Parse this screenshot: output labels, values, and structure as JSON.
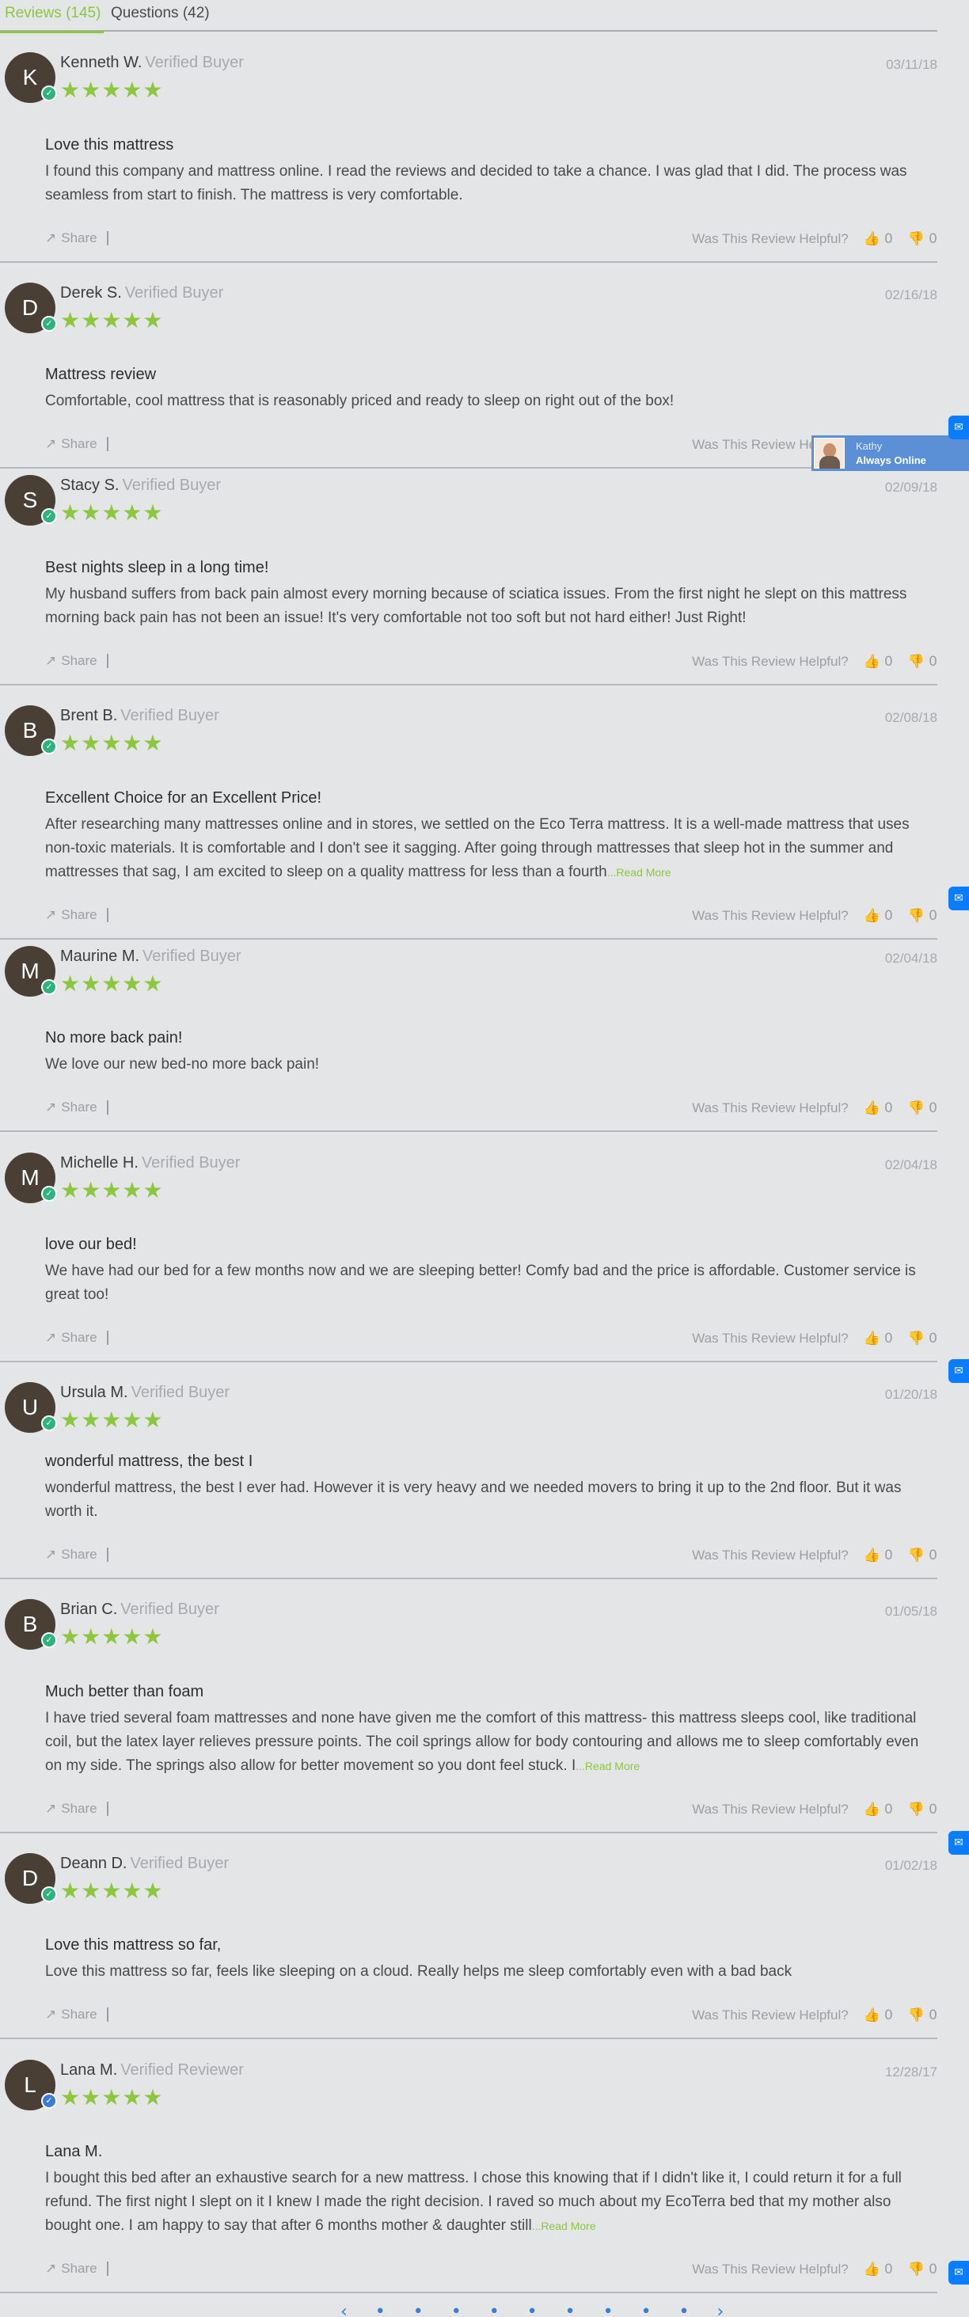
{
  "tabs": {
    "reviews": "Reviews (145)",
    "questions": "Questions (42)"
  },
  "labels": {
    "share": "Share",
    "helpful": "Was This Review Helpful?",
    "read_more": "...Read More",
    "stars": "★★★★★",
    "thumbs_up": "👍",
    "thumbs_down": "👎"
  },
  "chat": {
    "agent": "Kathy",
    "status": "Always Online"
  },
  "colors": {
    "accent": "#8dc63f",
    "avatar": "#4a3f35",
    "verified_badge": "#2eb37d",
    "reviewer_badge": "#3a7bd5",
    "messenger": "#0a7cff"
  },
  "reviews": [
    {
      "initial": "K",
      "name": "Kenneth W.",
      "status": "Verified Buyer",
      "date": "03/11/18",
      "rating": 5,
      "title": "Love this mattress",
      "body": "I found this company and mattress online. I read the reviews and decided to take a chance. I was glad that I did. The process was seamless from start to finish. The mattress is very comfortable.",
      "read_more": false,
      "up": "0",
      "down": "0"
    },
    {
      "initial": "D",
      "name": "Derek S.",
      "status": "Verified Buyer",
      "date": "02/16/18",
      "rating": 5,
      "title": "Mattress review",
      "body": "Comfortable, cool mattress that is reasonably priced and ready to sleep on right out of the box!",
      "read_more": false,
      "up": "0",
      "down": "0"
    },
    {
      "initial": "S",
      "name": "Stacy S.",
      "status": "Verified Buyer",
      "date": "02/09/18",
      "rating": 5,
      "title": "Best nights sleep in a long time!",
      "body": "My husband suffers from back pain almost every morning because of sciatica issues. From the first night he slept on this mattress morning back pain has not been an issue! It's very comfortable not too soft but not hard either! Just Right!",
      "read_more": false,
      "up": "0",
      "down": "0"
    },
    {
      "initial": "B",
      "name": "Brent B.",
      "status": "Verified Buyer",
      "date": "02/08/18",
      "rating": 5,
      "title": "Excellent Choice for an Excellent Price!",
      "body": "After researching many mattresses online and in stores, we settled on the Eco Terra mattress. It is a well-made mattress that uses non-toxic materials. It is comfortable and I don't see it sagging. After going through mattresses that sleep hot in the summer and mattresses that sag, I am excited to sleep on a quality mattress for less than a fourth",
      "read_more": true,
      "up": "0",
      "down": "0"
    },
    {
      "initial": "M",
      "name": "Maurine M.",
      "status": "Verified Buyer",
      "date": "02/04/18",
      "rating": 5,
      "title": "No more back pain!",
      "body": "We love our new bed-no more back pain!",
      "read_more": false,
      "up": "0",
      "down": "0"
    },
    {
      "initial": "M",
      "name": "Michelle H.",
      "status": "Verified Buyer",
      "date": "02/04/18",
      "rating": 5,
      "title": "love our bed!",
      "body": "We have had our bed for a few months now and we are sleeping better! Comfy bad and the price is affordable. Customer service is great too!",
      "read_more": false,
      "up": "0",
      "down": "0"
    },
    {
      "initial": "U",
      "name": "Ursula M.",
      "status": "Verified Buyer",
      "date": "01/20/18",
      "rating": 5,
      "title": "wonderful mattress, the best I",
      "body": "wonderful mattress, the best I ever had. However it is very heavy and we needed movers to bring it up to the 2nd floor. But it was worth it.",
      "read_more": false,
      "up": "0",
      "down": "0"
    },
    {
      "initial": "B",
      "name": "Brian C.",
      "status": "Verified Buyer",
      "date": "01/05/18",
      "rating": 5,
      "title": "Much better than foam",
      "body": "I have tried several foam mattresses and none have given me the comfort of this mattress- this mattress sleeps cool, like traditional coil, but the latex layer relieves pressure points. The coil springs allow for body contouring and allows me to sleep comfortably even on my side. The springs also allow for better movement so you dont feel stuck. I",
      "read_more": true,
      "up": "0",
      "down": "0"
    },
    {
      "initial": "D",
      "name": "Deann D.",
      "status": "Verified Buyer",
      "date": "01/02/18",
      "rating": 5,
      "title": "Love this mattress so far,",
      "body": "Love this mattress so far, feels like sleeping on a cloud. Really helps me sleep comfortably even with a bad back",
      "read_more": false,
      "up": "0",
      "down": "0"
    },
    {
      "initial": "L",
      "name": "Lana M.",
      "status": "Verified Reviewer",
      "date": "12/28/17",
      "rating": 5,
      "title": "Lana M.",
      "body": "I bought this bed after an exhaustive search for a new mattress. I chose this knowing that if I didn't like it, I could return it for a full refund. The first night I slept on it I knew I made the right decision. I raved so much about my EcoTerra bed that my mother also bought one. I am happy to say that after 6 months mother & daughter still",
      "read_more": true,
      "up": "0",
      "down": "0"
    }
  ],
  "pager": "‹ • • • • • • • • • ›"
}
